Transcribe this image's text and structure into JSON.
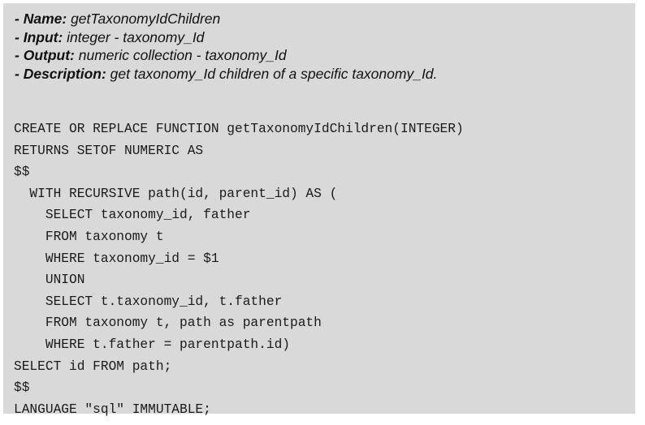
{
  "metadata": [
    {
      "dash": "- ",
      "key": "Name:",
      "value": " getTaxonomyIdChildren"
    },
    {
      "dash": "- ",
      "key": "Input:",
      "value": " integer - taxonomy_Id"
    },
    {
      "dash": "- ",
      "key": "Output:",
      "value": " numeric collection - taxonomy_Id"
    },
    {
      "dash": "- ",
      "key": "Description:",
      "value": " get taxonomy_Id children of a specific taxonomy_Id."
    }
  ],
  "code_lines": [
    "CREATE OR REPLACE FUNCTION getTaxonomyIdChildren(INTEGER)",
    "RETURNS SETOF NUMERIC AS",
    "$$",
    "  WITH RECURSIVE path(id, parent_id) AS (",
    "    SELECT taxonomy_id, father",
    "    FROM taxonomy t",
    "    WHERE taxonomy_id = $1",
    "    UNION",
    "    SELECT t.taxonomy_id, t.father",
    "    FROM taxonomy t, path as parentpath",
    "    WHERE t.father = parentpath.id)",
    "SELECT id FROM path;",
    "$$",
    "LANGUAGE \"sql\" IMMUTABLE;"
  ]
}
